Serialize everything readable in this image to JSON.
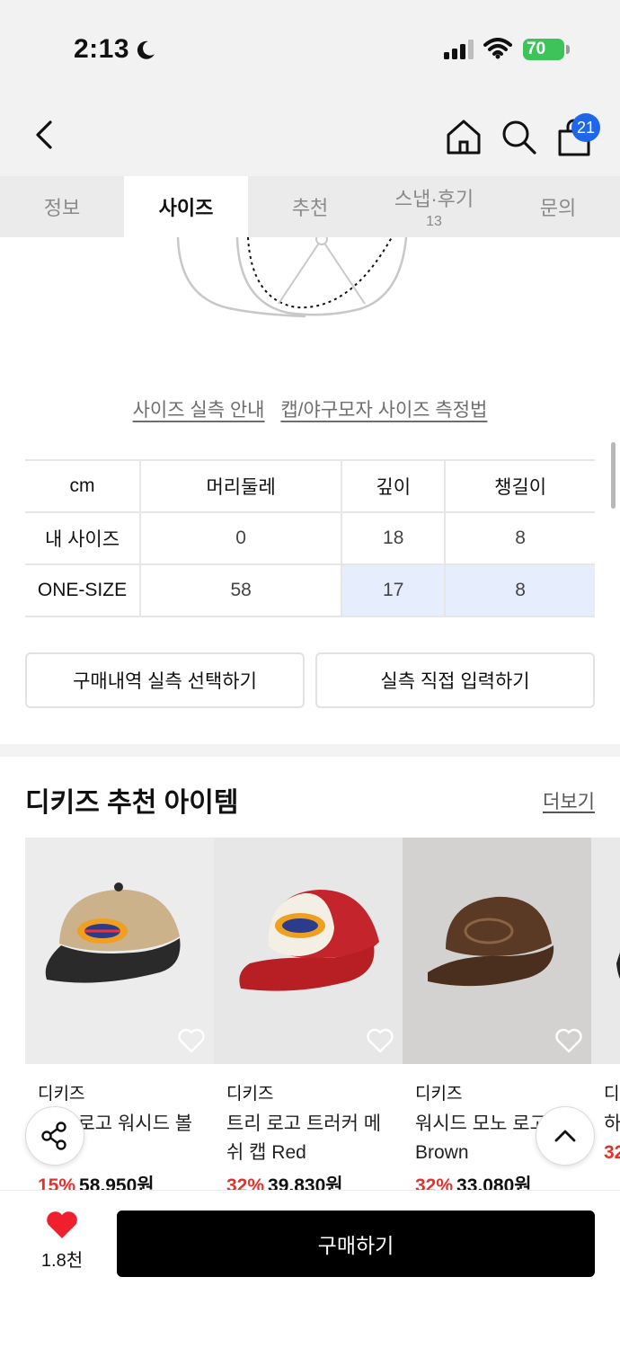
{
  "status_bar": {
    "time": "2:13",
    "battery": "70"
  },
  "header": {
    "cart_count": "21"
  },
  "tabs": [
    {
      "label": "정보",
      "count": ""
    },
    {
      "label": "사이즈",
      "count": ""
    },
    {
      "label": "추천",
      "count": ""
    },
    {
      "label": "스냅·후기",
      "count": "13"
    },
    {
      "label": "문의",
      "count": ""
    }
  ],
  "active_tab": "사이즈",
  "size_guide": {
    "link_guide": "사이즈 실측 안내",
    "link_measure": "캡/야구모자 사이즈 측정법",
    "columns": [
      "cm",
      "머리둘레",
      "깊이",
      "챙길이"
    ],
    "rows": [
      {
        "label": "내 사이즈",
        "values": [
          "0",
          "18",
          "8"
        ]
      },
      {
        "label": "ONE-SIZE",
        "values": [
          "58",
          "17",
          "8"
        ]
      }
    ],
    "btn_purchase_history": "구매내역 실측 선택하기",
    "btn_direct_input": "실측 직접 입력하기"
  },
  "recommend": {
    "title": "디키즈 추천 아이템",
    "more": "더보기",
    "products": [
      {
        "brand": "디키즈",
        "name": "트리 로고 워시드 볼캡",
        "discount": "15%",
        "price": "58,950원",
        "image": "beige-black-cap"
      },
      {
        "brand": "디키즈",
        "name": "트리 로고 트러커 메쉬 캡 Red",
        "discount": "32%",
        "price": "39,830원",
        "image": "red-trucker-cap"
      },
      {
        "brand": "디키즈",
        "name": "워시드 모노 로고 캡 Brown",
        "discount": "32%",
        "price": "33,080원",
        "image": "brown-cap"
      },
      {
        "brand": "디",
        "name": "하",
        "discount": "32",
        "price": "",
        "image": "partial-cap"
      }
    ]
  },
  "bottom_bar": {
    "like_count": "1.8천",
    "buy_label": "구매하기"
  },
  "colors": {
    "accent_blue": "#1f66e8",
    "discount_red": "#e5312d",
    "heart_red": "#ef1f2d",
    "highlight": "#e6eefd"
  }
}
